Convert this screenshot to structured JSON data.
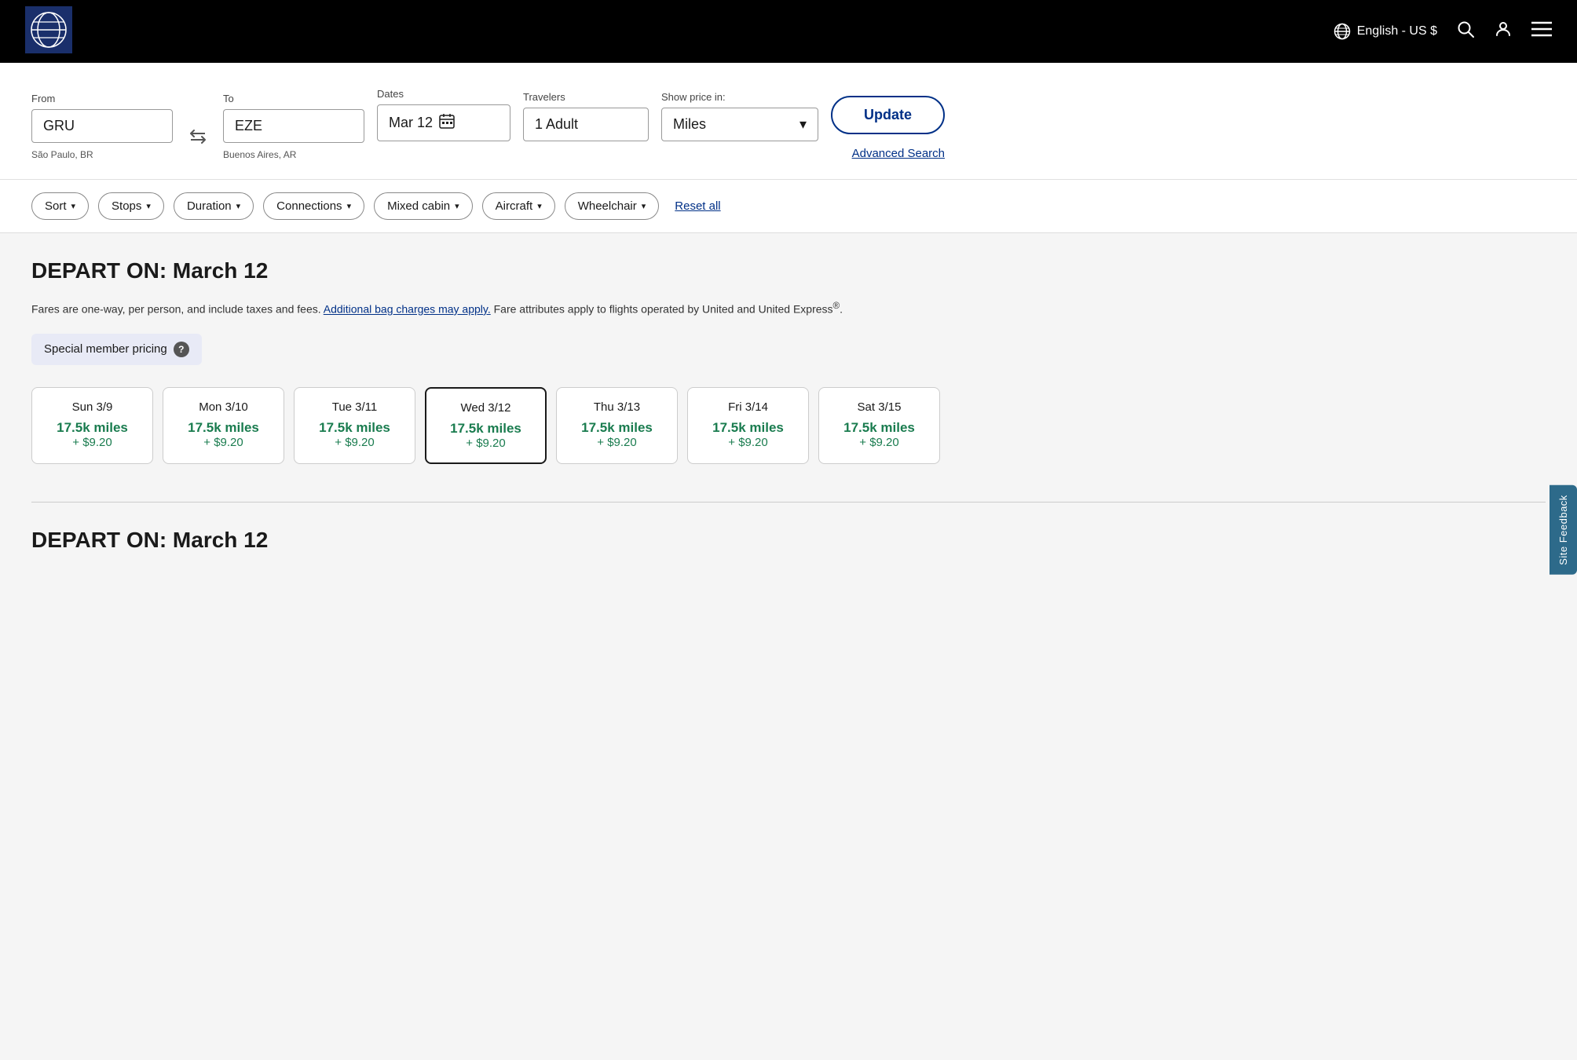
{
  "header": {
    "lang_label": "English - US $",
    "search_icon": "🔍",
    "user_icon": "👤",
    "menu_icon": "☰"
  },
  "search_form": {
    "from_label": "From",
    "from_value": "GRU",
    "from_hint": "São Paulo, BR",
    "to_label": "To",
    "to_value": "EZE",
    "to_hint": "Buenos Aires, AR",
    "dates_label": "Dates",
    "dates_value": "Mar 12",
    "travelers_label": "Travelers",
    "travelers_value": "1 Adult",
    "show_price_label": "Show price in:",
    "price_value": "Miles",
    "update_btn": "Update",
    "advanced_search": "Advanced Search"
  },
  "filters": {
    "sort": "Sort",
    "stops": "Stops",
    "duration": "Duration",
    "connections": "Connections",
    "mixed_cabin": "Mixed cabin",
    "aircraft": "Aircraft",
    "wheelchair": "Wheelchair",
    "reset": "Reset all"
  },
  "results": {
    "depart_title": "DEPART ON: March 12",
    "fare_note": "Fares are one-way, per person, and include taxes and fees.",
    "fare_link": "Additional bag charges may apply.",
    "fare_note2": "Fare attributes apply to flights operated by United and United Express",
    "fare_trademark": "®",
    "fare_period": ".",
    "member_pricing": "Special member pricing",
    "date_cards": [
      {
        "label": "Sun 3/9",
        "miles": "17.5k miles",
        "fee": "+ $9.20",
        "selected": false
      },
      {
        "label": "Mon 3/10",
        "miles": "17.5k miles",
        "fee": "+ $9.20",
        "selected": false
      },
      {
        "label": "Tue 3/11",
        "miles": "17.5k miles",
        "fee": "+ $9.20",
        "selected": false
      },
      {
        "label": "Wed 3/12",
        "miles": "17.5k miles",
        "fee": "+ $9.20",
        "selected": true
      },
      {
        "label": "Thu 3/13",
        "miles": "17.5k miles",
        "fee": "+ $9.20",
        "selected": false
      },
      {
        "label": "Fri 3/14",
        "miles": "17.5k miles",
        "fee": "+ $9.20",
        "selected": false
      },
      {
        "label": "Sat 3/15",
        "miles": "17.5k miles",
        "fee": "+ $9.20",
        "selected": false
      }
    ],
    "depart_title2": "DEPART ON: March 12"
  },
  "feedback": {
    "label": "Site Feedback"
  }
}
